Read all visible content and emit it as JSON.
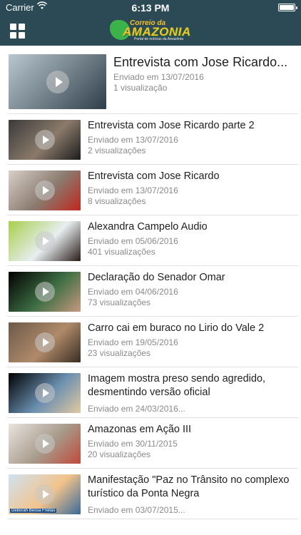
{
  "status_bar": {
    "carrier": "Carrier",
    "time": "6:13 PM"
  },
  "header": {
    "logo_line1": "Correio da",
    "logo_line2": "AMAZONIA",
    "logo_tagline": "Portal de notícias da Amazônia"
  },
  "videos": [
    {
      "title": "Entrevista com Jose Ricardo...",
      "date": "Enviado em 13/07/2016",
      "views": "1  visualização",
      "thumb_colors": [
        "#b9c7cf",
        "#6e7d86",
        "#2f3d4a"
      ]
    },
    {
      "title": "Entrevista com Jose Ricardo parte 2",
      "date": "Enviado em 13/07/2016",
      "views": "2 visualizações",
      "thumb_colors": [
        "#3a3a3a",
        "#8b7a6a",
        "#1d1d1d"
      ]
    },
    {
      "title": "Entrevista com Jose Ricardo",
      "date": "Enviado em 13/07/2016",
      "views": "8 visualizações",
      "thumb_colors": [
        "#d8d0c8",
        "#8a7a6e",
        "#c0271f"
      ]
    },
    {
      "title": "Alexandra Campelo Audio",
      "date": "Enviado em 05/06/2016",
      "views": "401 visualizações",
      "thumb_colors": [
        "#a7cf4a",
        "#e7eef0",
        "#2a1c18"
      ]
    },
    {
      "title": "Declaração do Senador Omar",
      "date": "Enviado em 04/06/2016",
      "views": "73 visualizações",
      "thumb_colors": [
        "#000000",
        "#3f6f45",
        "#c69a7e"
      ]
    },
    {
      "title": "Carro cai em buraco no Lirio do Vale 2",
      "date": "Enviado em 19/05/2016",
      "views": "23 visualizações",
      "thumb_colors": [
        "#6b5a4a",
        "#b08a6a",
        "#3a2d22"
      ]
    },
    {
      "title": "Imagem mostra preso sendo agredido, desmentindo versão oficial",
      "date": "Enviado em 24/03/2016...",
      "views": "",
      "thumb_colors": [
        "#000000",
        "#6a8fb0",
        "#e2c9a0"
      ]
    },
    {
      "title": "Amazonas em Ação III",
      "date": "Enviado em 30/11/2015",
      "views": "20 visualizações",
      "thumb_colors": [
        "#e9e4df",
        "#a79a8a",
        "#c04a3a"
      ]
    },
    {
      "title": "Manifestação \"Paz no Trânsito no complexo turístico da Ponta Negra",
      "date": "Enviado em 03/07/2015...",
      "views": "",
      "thumb_colors": [
        "#cfe2f0",
        "#f2c38a",
        "#3a6a9a"
      ],
      "caption": "Deborah Bessa Freitas"
    }
  ]
}
